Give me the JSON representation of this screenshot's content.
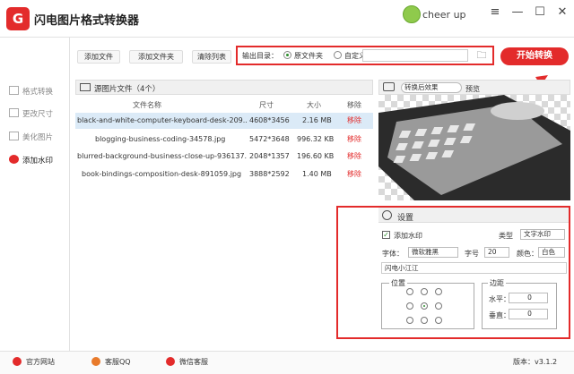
{
  "app": {
    "title": "闪电图片格式转换器",
    "logo_text": "G",
    "username": "cheer up",
    "accent": "#e32b2b"
  },
  "window_controls": [
    "≡",
    "—",
    "☐",
    "✕"
  ],
  "sidebar": {
    "items": [
      {
        "label": "格式转换",
        "icon": "convert-icon",
        "active": false
      },
      {
        "label": "更改尺寸",
        "icon": "resize-icon",
        "active": false
      },
      {
        "label": "美化图片",
        "icon": "beautify-icon",
        "active": false
      },
      {
        "label": "添加水印",
        "icon": "watermark-icon",
        "active": true
      }
    ]
  },
  "toolbar": {
    "add_file": "添加文件",
    "add_folder": "添加文件夹",
    "clear_list": "清除列表",
    "output_label": "输出目录：",
    "opt_source": "原文件夹",
    "opt_custom": "自定义",
    "path_value": "",
    "start": "开始转换"
  },
  "files": {
    "header": "源图片文件（4个）",
    "columns": [
      "文件名称",
      "尺寸",
      "大小",
      "移除"
    ],
    "rows": [
      {
        "name": "black-and-white-computer-keyboard-desk-209...",
        "size": "4608*3456",
        "bytes": "2.16 MB",
        "remove": "移除",
        "selected": true
      },
      {
        "name": "blogging-business-coding-34578.jpg",
        "size": "5472*3648",
        "bytes": "996.32 KB",
        "remove": "移除",
        "selected": false
      },
      {
        "name": "blurred-background-business-close-up-936137...",
        "size": "2048*1357",
        "bytes": "196.60 KB",
        "remove": "移除",
        "selected": false
      },
      {
        "name": "book-bindings-composition-desk-891059.jpg",
        "size": "3888*2592",
        "bytes": "1.40 MB",
        "remove": "移除",
        "selected": false
      }
    ]
  },
  "preview": {
    "mode": "转换后效果",
    "label": "预览"
  },
  "settings": {
    "title": "设置",
    "add_watermark": "添加水印",
    "type_label": "类型",
    "type_value": "文字水印",
    "font_label": "字体：",
    "font_value": "微软雅黑",
    "size_label": "字号",
    "size_value": "20",
    "color_label": "颜色：",
    "color_value": "白色",
    "text_value": "闪电小江江",
    "position_label": "位置",
    "margin_label": "边距",
    "h_label": "水平：",
    "h_value": "0",
    "v_label": "垂直：",
    "v_value": "0"
  },
  "footer": {
    "site": "官方网站",
    "qq": "客服QQ",
    "wechat": "微信客服",
    "version": "版本：v3.1.2"
  }
}
